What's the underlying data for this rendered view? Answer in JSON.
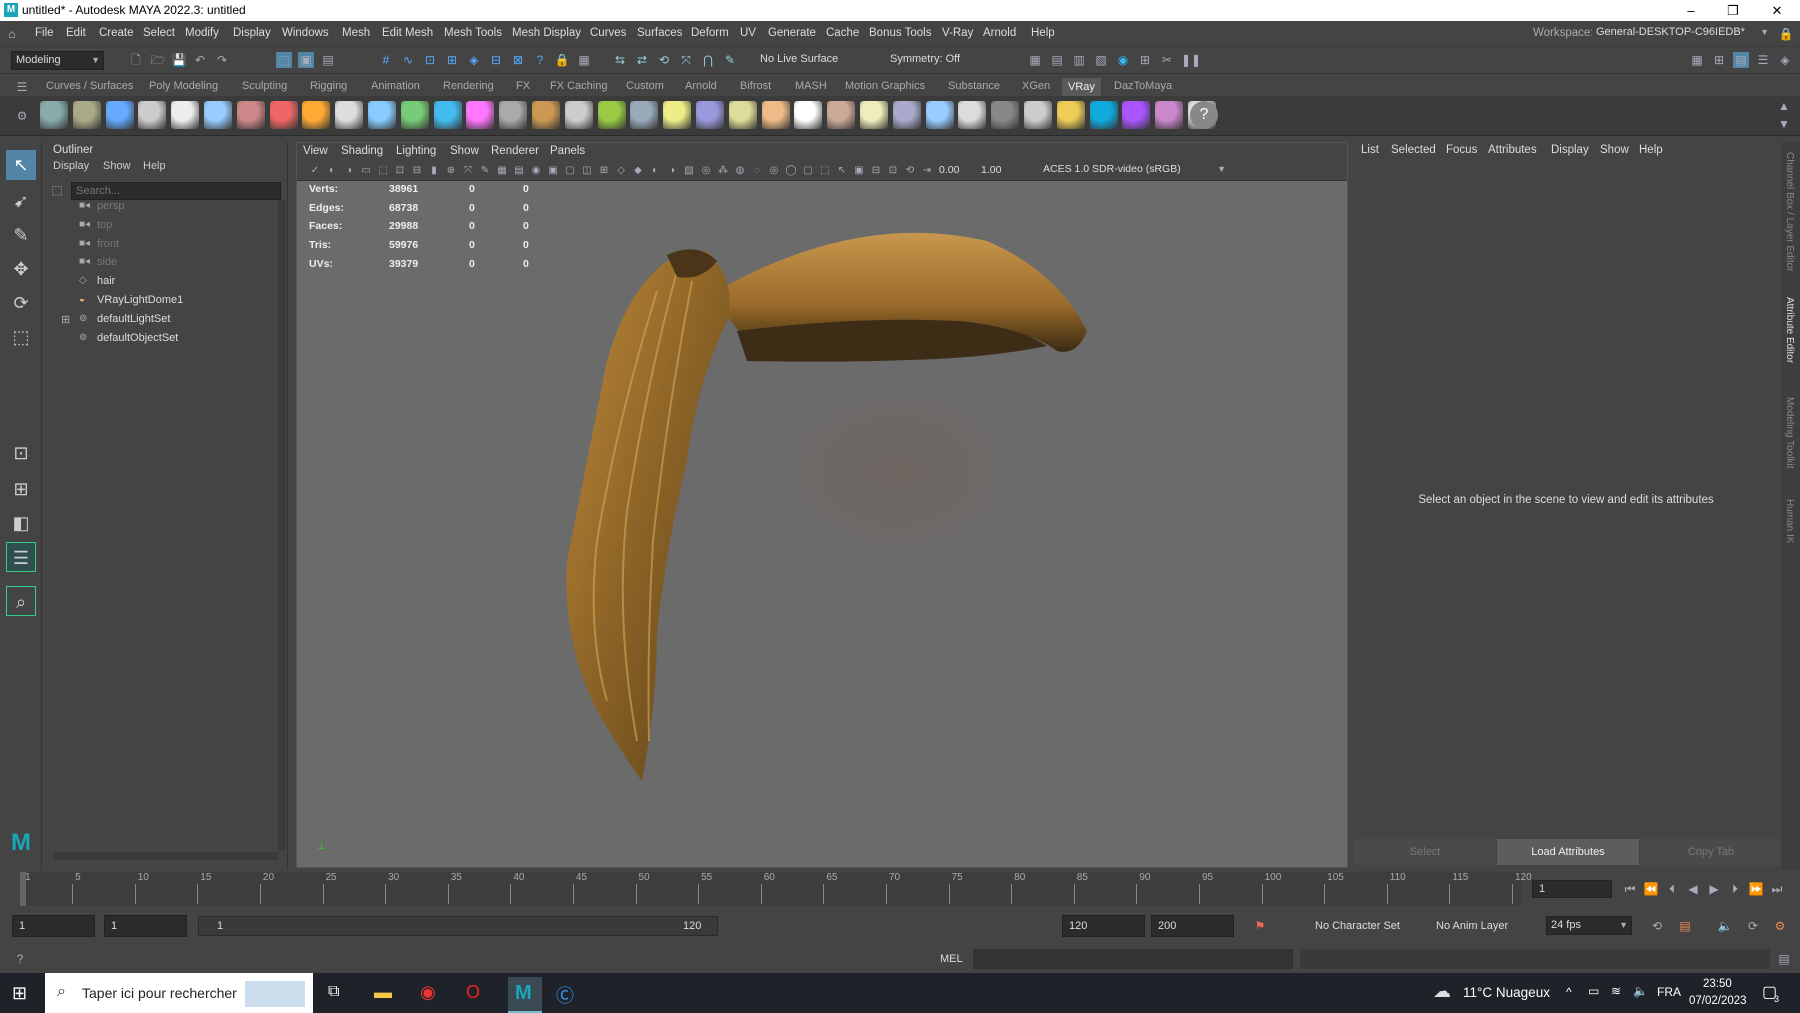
{
  "window": {
    "title": "untitled* - Autodesk MAYA 2022.3: untitled",
    "minimize": "–",
    "restore": "❐",
    "close": "✕"
  },
  "menubar": {
    "items": [
      "File",
      "Edit",
      "Create",
      "Select",
      "Modify",
      "Display",
      "Windows",
      "Mesh",
      "Edit Mesh",
      "Mesh Tools",
      "Mesh Display",
      "Curves",
      "Surfaces",
      "Deform",
      "UV",
      "Generate",
      "Cache",
      "Bonus Tools",
      "V-Ray",
      "Arnold",
      "Help"
    ],
    "workspace_label": "Workspace:",
    "workspace_value": "General-DESKTOP-C96IEDB*"
  },
  "statusline": {
    "mode": "Modeling",
    "live_surface": "No Live Surface",
    "symmetry": "Symmetry: Off"
  },
  "shelf": {
    "tabs": [
      "Curves / Surfaces",
      "Poly Modeling",
      "Sculpting",
      "Rigging",
      "Animation",
      "Rendering",
      "FX",
      "FX Caching",
      "Custom",
      "Arnold",
      "Bifrost",
      "MASH",
      "Motion Graphics",
      "Substance",
      "XGen",
      "VRay",
      "DazToMaya"
    ],
    "active": "VRay",
    "icon_colors": [
      "#8aa",
      "#aa8",
      "#6af",
      "#ccc",
      "#eee",
      "#9cf",
      "#c88",
      "#e66",
      "#fa3",
      "#ddd",
      "#8cf",
      "#7c7",
      "#4be",
      "#f7f",
      "#aaa",
      "#c95",
      "#ccc",
      "#9c4",
      "#9ab",
      "#ee8",
      "#99d",
      "#dd9",
      "#eb8",
      "#fff",
      "#ca9",
      "#eeb",
      "#aac",
      "#9cf",
      "#ddd",
      "#888",
      "#ccc",
      "#ec5",
      "#1ad",
      "#a5f",
      "#c8c",
      "#ddd"
    ]
  },
  "outliner": {
    "title": "Outliner",
    "menus": [
      "Display",
      "Show",
      "Help"
    ],
    "search_placeholder": "Search...",
    "items": [
      {
        "label": "persp",
        "icon": "camera-icon",
        "dim": true
      },
      {
        "label": "top",
        "icon": "camera-icon",
        "dim": true
      },
      {
        "label": "front",
        "icon": "camera-icon",
        "dim": true
      },
      {
        "label": "side",
        "icon": "camera-icon",
        "dim": true
      },
      {
        "label": "hair",
        "icon": "mesh-icon",
        "dim": false
      },
      {
        "label": "VRayLightDome1",
        "icon": "dome-light-icon",
        "dim": false
      },
      {
        "label": "defaultLightSet",
        "icon": "set-icon",
        "dim": false,
        "expand": "⊞"
      },
      {
        "label": "defaultObjectSet",
        "icon": "set-icon",
        "dim": false
      }
    ]
  },
  "viewport": {
    "menus": [
      "View",
      "Shading",
      "Lighting",
      "Show",
      "Renderer",
      "Panels"
    ],
    "exposure": "0.00",
    "gamma": "1.00",
    "colorspace": "ACES 1.0 SDR-video (sRGB)",
    "hud": [
      {
        "label": "Verts:",
        "a": "38961",
        "b": "0",
        "c": "0"
      },
      {
        "label": "Edges:",
        "a": "68738",
        "b": "0",
        "c": "0"
      },
      {
        "label": "Faces:",
        "a": "29988",
        "b": "0",
        "c": "0"
      },
      {
        "label": "Tris:",
        "a": "59976",
        "b": "0",
        "c": "0"
      },
      {
        "label": "UVs:",
        "a": "39379",
        "b": "0",
        "c": "0"
      }
    ]
  },
  "attribute_editor": {
    "menus": [
      "List",
      "Selected",
      "Focus",
      "Attributes",
      "Display",
      "Show",
      "Help"
    ],
    "message": "Select an object in the scene to view and edit its attributes",
    "buttons": {
      "select": "Select",
      "load": "Load Attributes",
      "copy": "Copy Tab"
    }
  },
  "side_tabs": [
    "Channel Box / Layer Editor",
    "Attribute Editor",
    "Modeling Toolkit",
    "Human IK"
  ],
  "timeslider": {
    "ticks": [
      "1",
      "5",
      "10",
      "15",
      "20",
      "25",
      "30",
      "35",
      "40",
      "45",
      "50",
      "55",
      "60",
      "65",
      "70",
      "75",
      "80",
      "85",
      "90",
      "95",
      "100",
      "105",
      "110",
      "115",
      "120"
    ],
    "current_frame": "1"
  },
  "range": {
    "start": "1",
    "start2": "1",
    "slider_start": "1",
    "slider_end": "120",
    "end": "120",
    "end2": "200",
    "character_set": "No Character Set",
    "anim_layer": "No Anim Layer",
    "fps": "24 fps"
  },
  "command": {
    "lang": "MEL"
  },
  "taskbar": {
    "search": "Taper ici pour rechercher",
    "weather": "11°C  Nuageux",
    "lang": "FRA",
    "time": "23:50",
    "date": "07/02/2023",
    "notifications": "3"
  }
}
